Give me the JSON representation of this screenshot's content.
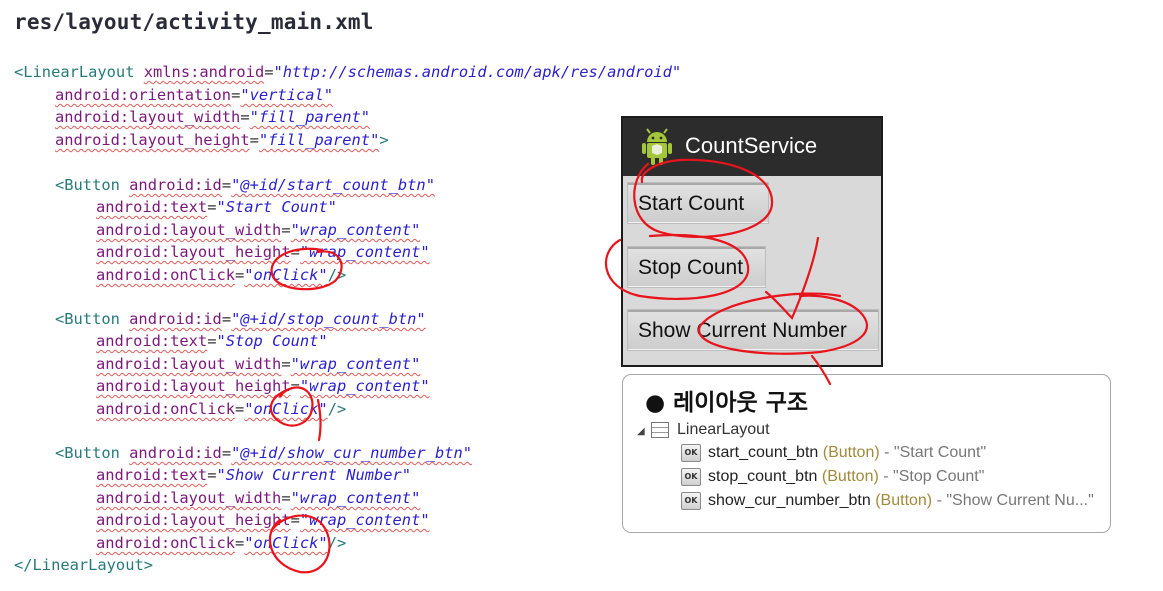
{
  "file_title": "res/layout/activity_main.xml",
  "code": {
    "root_open": {
      "tag": "<LinearLayout",
      "attr": "xmlns:android",
      "value": "\"http://schemas.android.com/apk/res/android\""
    },
    "root_attrs": [
      {
        "attr": "android:orientation",
        "value": "\"vertical\""
      },
      {
        "attr": "android:layout_width",
        "value": "\"fill_parent\""
      },
      {
        "attr": "android:layout_height",
        "value": "\"fill_parent\"",
        "close": ">"
      }
    ],
    "buttons": [
      {
        "id": "\"@+id/start_count_btn\"",
        "text": "\"Start Count\"",
        "width": "\"wrap_content\"",
        "height": "\"wrap_content\"",
        "onclick": "\"onClick\""
      },
      {
        "id": "\"@+id/stop_count_btn\"",
        "text": "\"Stop Count\"",
        "width": "\"wrap_content\"",
        "height": "\"wrap_content\"",
        "onclick": "\"onClick\""
      },
      {
        "id": "\"@+id/show_cur_number_btn\"",
        "text": "\"Show Current Number\"",
        "width": "\"wrap_content\"",
        "height": "\"wrap_content\"",
        "onclick": "\"onClick\""
      }
    ],
    "labels": {
      "button_tag": "<Button",
      "attr_id": "android:id",
      "attr_text": "android:text",
      "attr_width": "android:layout_width",
      "attr_height": "android:layout_height",
      "attr_onclick": "android:onClick",
      "self_close": "/>",
      "eq": "="
    },
    "root_close": "</LinearLayout>"
  },
  "phone": {
    "app_title": "CountService",
    "buttons": [
      "Start Count",
      "Stop Count",
      "Show Current Number"
    ]
  },
  "layout_panel": {
    "title": "● 레이아웃 구조",
    "root": "LinearLayout",
    "ok_label": "OK",
    "items": [
      {
        "name": "start_count_btn",
        "type": "(Button)",
        "text": " - \"Start Count\""
      },
      {
        "name": "stop_count_btn",
        "type": "(Button)",
        "text": " - \"Stop Count\""
      },
      {
        "name": "show_cur_number_btn",
        "type": "(Button)",
        "text": " - \"Show Current Nu...\""
      }
    ]
  },
  "colors": {
    "annotation": "#e8141c",
    "tag": "#267a7a",
    "attr": "#7c177c",
    "value": "#2a1fcf"
  }
}
